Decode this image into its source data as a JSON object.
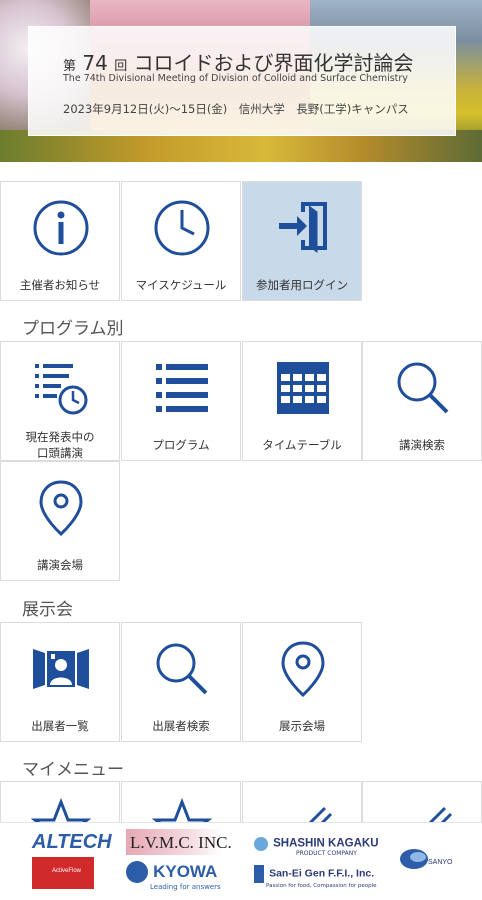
{
  "banner": {
    "title_prefix": "第",
    "title_num": "74",
    "title_kai": "回",
    "title_main": "コロイドおよび界面化学討論会",
    "subtitle": "The 74th Divisional Meeting of Division of Colloid and Surface Chemistry",
    "date_venue": "2023年9月12日(火)～15日(金)　信州大学　長野(工学)キャンパス"
  },
  "top_tiles": [
    {
      "label": "主催者お知らせ"
    },
    {
      "label": "マイスケジュール"
    },
    {
      "label": "参加者用ログイン"
    }
  ],
  "sections": {
    "program": "プログラム別",
    "exhibition": "展示会",
    "mymenu": "マイメニュー"
  },
  "program_tiles": [
    {
      "label_line1": "現在発表中の",
      "label_line2": "口頭講演"
    },
    {
      "label": "プログラム"
    },
    {
      "label": "タイムテーブル"
    },
    {
      "label": "講演検索"
    },
    {
      "label": "講演会場"
    }
  ],
  "exhibition_tiles": [
    {
      "label": "出展者一覧"
    },
    {
      "label": "出展者検索"
    },
    {
      "label": "展示会場"
    }
  ],
  "sponsors": {
    "altech": "ALTECH",
    "lvmc": "L.V.M.C. INC.",
    "shashin": "SHASHIN KAGAKU",
    "shashin_sub": "PRODUCT COMPANY",
    "kyowa": "KYOWA",
    "kyowa_sub": "Leading for answers",
    "sanei": "San-Ei Gen F.F.I., Inc.",
    "sanei_sub": "Passion for food, Compassion for people",
    "sanyo": "SANYO",
    "activeflow": "ActiveFlow"
  },
  "colors": {
    "icon_blue": "#1f4e9a",
    "active_tile": "#c8d9ea"
  }
}
